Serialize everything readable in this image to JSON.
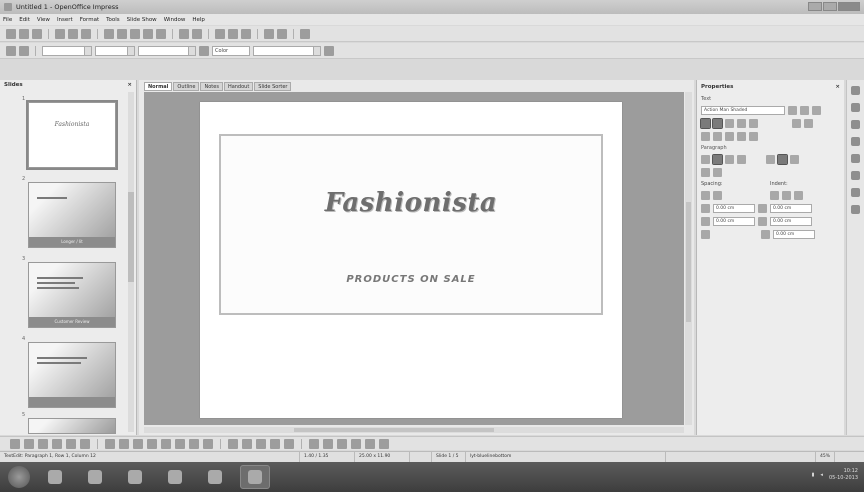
{
  "window": {
    "title": "Untitled 1 - OpenOffice Impress"
  },
  "menu": [
    "File",
    "Edit",
    "View",
    "Insert",
    "Format",
    "Tools",
    "Slide Show",
    "Window",
    "Help"
  ],
  "toolbar2": {
    "font_combo": "",
    "color_label": "Color"
  },
  "slides_pane": {
    "title": "Slides",
    "close": "×",
    "slides": [
      {
        "number": "1",
        "title": "Fashionista"
      },
      {
        "number": "2",
        "title": "",
        "caption": "Longer / lit"
      },
      {
        "number": "3",
        "title": "",
        "caption": "Customer Review"
      },
      {
        "number": "4",
        "title": "",
        "caption": ""
      },
      {
        "number": "5",
        "title": "",
        "caption": ""
      }
    ]
  },
  "view_tabs": [
    "Normal",
    "Outline",
    "Notes",
    "Handout",
    "Slide Sorter"
  ],
  "slide": {
    "title": "Fashionista",
    "subtitle": "PRODUCTS ON SALE"
  },
  "properties": {
    "title": "Properties",
    "close": "×",
    "text_section": "Text",
    "font_name": "Action Man Shaded",
    "paragraph_section": "Paragraph",
    "spacing_label": "Spacing:",
    "indent_label": "Indent:",
    "spacing_above": "0.00 cm",
    "spacing_below": "0.00 cm",
    "indent_before": "0.00 cm",
    "indent_after": "0.00 cm",
    "first_line": "0.00 cm"
  },
  "statusbar": {
    "edit_position": "TextEdit: Paragraph 1, Row 1, Column 12",
    "position": "1.40 / 1.35",
    "size": "25.00 x 11.90",
    "slide": "Slide 1 / 5",
    "layout": "lyt-bluelinebottom",
    "zoom": "45%"
  },
  "taskbar": {
    "time": "10:12",
    "date": "05-10-2013"
  }
}
